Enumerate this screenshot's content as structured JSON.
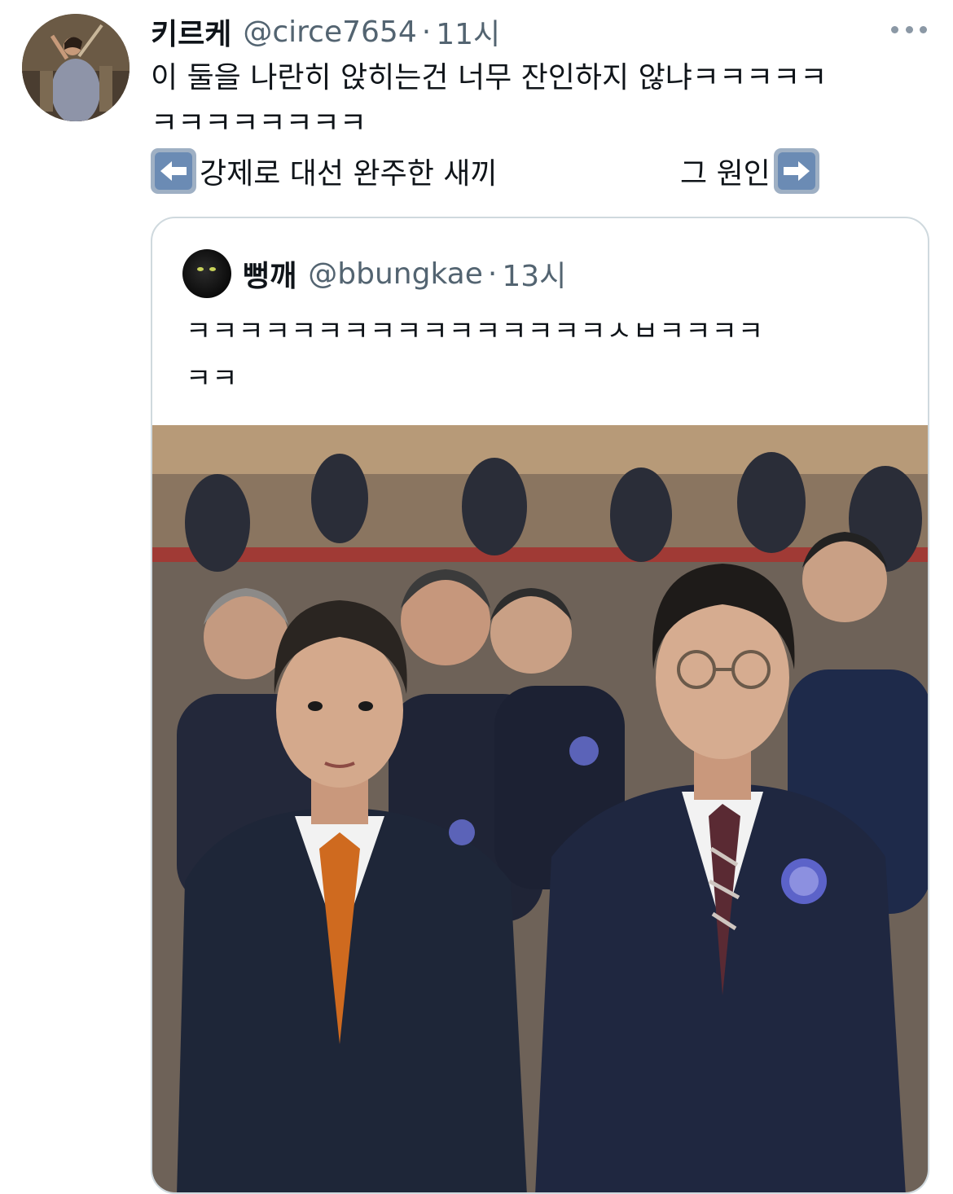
{
  "tweet": {
    "author_name": "키르케",
    "author_handle": "@circe7654",
    "separator": "·",
    "time": "11시",
    "text_line1": "이 둘을 나란히 앉히는건 너무 잔인하지 않냐ㅋㅋㅋㅋㅋ",
    "text_line2": "ㅋㅋㅋㅋㅋㅋㅋㅋ",
    "left_caption": "강제로 대선 완주한 새끼",
    "right_caption": "그 원인"
  },
  "quoted": {
    "author_name": "뻥깨",
    "author_handle": "@bbungkae",
    "separator": "·",
    "time": "13시",
    "text_line1": "ㅋㅋㅋㅋㅋㅋㅋㅋㅋㅋㅋㅋㅋㅋㅋㅋㅅㅂㅋㅋㅋㅋ",
    "text_line2": "ㅋㅋ"
  },
  "icons": {
    "more": "more-horizontal-icon",
    "left_arrow": "left-arrow-emoji",
    "right_arrow": "right-arrow-emoji"
  },
  "colors": {
    "text_primary": "#0f1419",
    "text_secondary": "#536471",
    "card_border": "#cfd9de",
    "arrow_emoji_bg": "#6b8bb4"
  }
}
